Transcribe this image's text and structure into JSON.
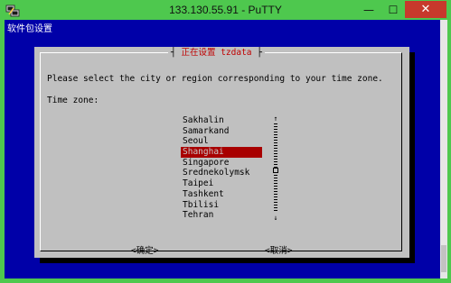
{
  "window": {
    "title": "133.130.55.91 - PuTTY",
    "minimize_glyph": "—",
    "maximize_glyph": "☐",
    "close_glyph": "✕",
    "icons": [
      "putty-app-icon",
      "minimize-icon",
      "maximize-icon",
      "close-icon"
    ]
  },
  "terminal": {
    "header": "软件包设置",
    "colors": {
      "background": "#0000a8",
      "dialog": "#c0c0c0",
      "selection": "#a80000",
      "title": "#c00000"
    }
  },
  "dialog": {
    "title": "正在设置 tzdata",
    "title_left_tick": "┤",
    "title_right_tick": "├",
    "prompt": "Please select the city or region corresponding to your time zone.",
    "list_label": "Time zone:",
    "items": [
      "Sakhalin",
      "Samarkand",
      "Seoul",
      "Shanghai",
      "Singapore",
      "Srednekolymsk",
      "Taipei",
      "Tashkent",
      "Tbilisi",
      "Tehran"
    ],
    "selected": "Shanghai",
    "scroll_up": "↑",
    "scroll_down": "↓",
    "ok_label": "<确定>",
    "cancel_label": "<取消>"
  }
}
